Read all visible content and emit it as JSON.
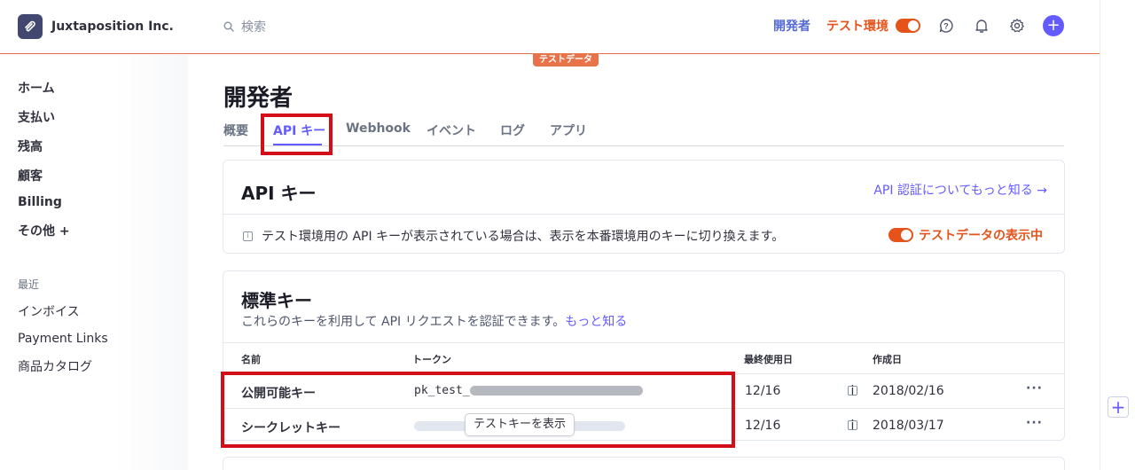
{
  "brand": {
    "name": "Juxtaposition Inc."
  },
  "search": {
    "placeholder": "検索"
  },
  "topbar": {
    "developers_link": "開発者",
    "test_mode_label": "テスト環境",
    "test_badge": "テストデータ"
  },
  "sidebar": {
    "items": [
      {
        "label": "ホーム"
      },
      {
        "label": "支払い"
      },
      {
        "label": "残高"
      },
      {
        "label": "顧客"
      },
      {
        "label": "Billing"
      },
      {
        "label": "その他 +"
      }
    ],
    "recent_heading": "最近",
    "recent_items": [
      {
        "label": "インボイス"
      },
      {
        "label": "Payment Links"
      },
      {
        "label": "商品カタログ"
      }
    ]
  },
  "main": {
    "title": "開発者",
    "tabs": [
      {
        "label": "概要"
      },
      {
        "label": "API キー"
      },
      {
        "label": "Webhook"
      },
      {
        "label": "イベント"
      },
      {
        "label": "ログ"
      },
      {
        "label": "アプリ"
      }
    ],
    "active_tab": "API キー"
  },
  "api_card": {
    "title": "API キー",
    "learn_link": "API 認証についてもっと知る →",
    "notice": "テスト環境用の API キーが表示されている場合は、表示を本番環境用のキーに切り換えます。",
    "test_data_toggle": "テストデータの表示中"
  },
  "standard_keys": {
    "title": "標準キー",
    "description": "これらのキーを利用して API リクエストを認証できます。",
    "more_link": "もっと知る",
    "columns": {
      "name": "名前",
      "token": "トークン",
      "last_used": "最終使用日",
      "created": "作成日"
    },
    "rows": [
      {
        "name": "公開可能キー",
        "token_prefix": "pk_test_",
        "last_used": "12/16",
        "created": "2018/02/16"
      },
      {
        "name": "シークレットキー",
        "reveal_button": "テストキーを表示",
        "last_used": "12/16",
        "created": "2018/03/17"
      }
    ],
    "more_menu": "···"
  },
  "colors": {
    "accent": "#635bff",
    "test_orange": "#e5531b",
    "highlight_red": "#d40e18"
  }
}
